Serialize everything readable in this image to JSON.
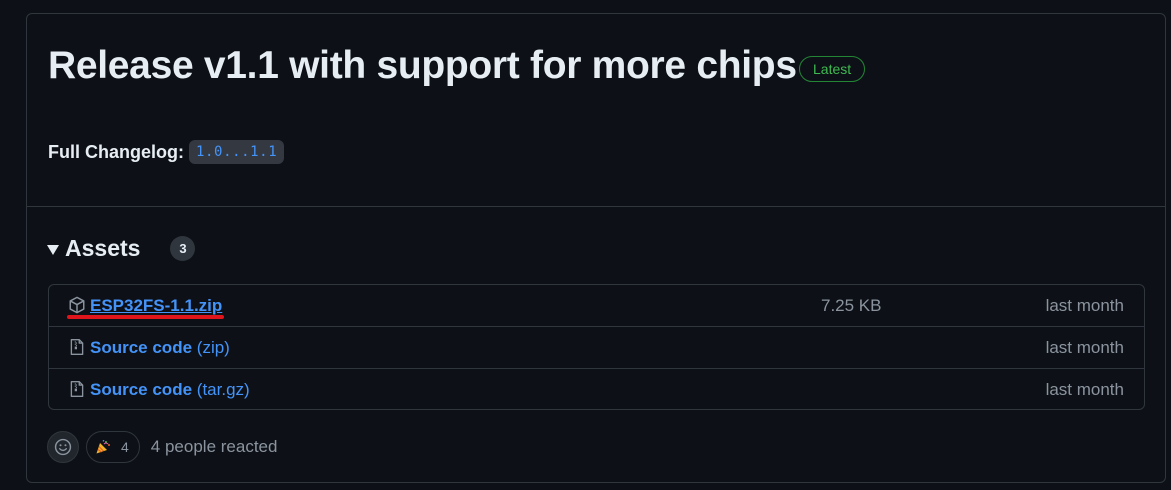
{
  "release": {
    "title": "Release v1.1 with support for more chips",
    "badge": "Latest",
    "changelog_label": "Full Changelog:",
    "compare_link": "1.0...1.1"
  },
  "assets": {
    "heading": "Assets",
    "count": "3",
    "rows": [
      {
        "icon": "package-icon",
        "name": "ESP32FS-1.1.zip",
        "name_suffix": "",
        "size": "7.25 KB",
        "date": "last month"
      },
      {
        "icon": "file-zip-icon",
        "name": "Source code",
        "name_suffix": "(zip)",
        "size": "",
        "date": "last month"
      },
      {
        "icon": "file-zip-icon",
        "name": "Source code",
        "name_suffix": "(tar.gz)",
        "size": "",
        "date": "last month"
      }
    ]
  },
  "reactions": {
    "tada_count": "4",
    "summary": "4 people reacted"
  },
  "colors": {
    "background": "#0d1117",
    "border": "#30363d",
    "link": "#4493f8",
    "latest_green": "#3fb950",
    "annotation_red": "#e0151b"
  }
}
